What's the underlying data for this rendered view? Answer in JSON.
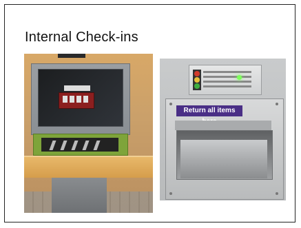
{
  "slide": {
    "title": "Internal Check-ins"
  },
  "photos": [
    {
      "name": "kiosk-photo"
    },
    {
      "name": "return-slot-photo",
      "label_text": "Return all items here"
    }
  ]
}
